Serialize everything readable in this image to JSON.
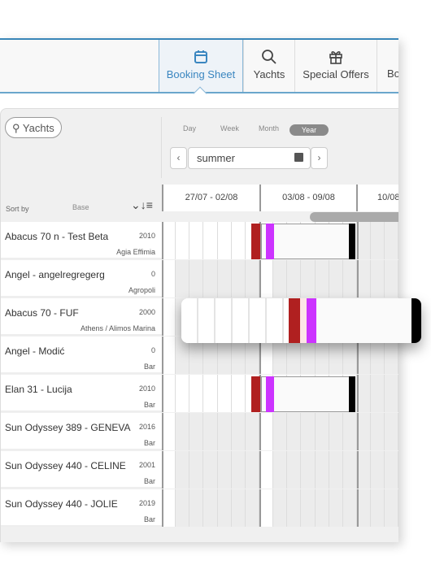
{
  "nav": {
    "tabs": [
      {
        "label": "Booking Sheet",
        "icon": "calendar-icon",
        "active": true
      },
      {
        "label": "Yachts",
        "icon": "search-icon"
      },
      {
        "label": "Special Offers",
        "icon": "gift-icon"
      },
      {
        "label": "Bo",
        "icon": ""
      }
    ]
  },
  "toolbar": {
    "search_label": "Yachts",
    "views": [
      "Day",
      "Week",
      "Month",
      "Year"
    ],
    "active_view": "Year",
    "period": "summer",
    "prev": "‹",
    "next": "›"
  },
  "list_header": {
    "sort_by": "Sort by",
    "sort_field": "Base"
  },
  "weeks": [
    "27/07 - 02/08",
    "03/08 - 09/08",
    "10/08"
  ],
  "yachts": [
    {
      "name": "Abacus 70 n - Test Beta",
      "year": "2010",
      "base": "Agia Effimia",
      "booking": true
    },
    {
      "name": "Angel - angelregregerg",
      "year": "0",
      "base": "Agropoli",
      "booking": false
    },
    {
      "name": "Abacus 70 - FUF",
      "year": "2000",
      "base": "Athens / Alimos Marina",
      "booking": false
    },
    {
      "name": "Angel - Modić",
      "year": "0",
      "base": "Bar",
      "booking": false
    },
    {
      "name": "Elan 31 - Lucija",
      "year": "2010",
      "base": "Bar",
      "booking": true
    },
    {
      "name": "Sun Odyssey 389 - GENEVA",
      "year": "2016",
      "base": "Bar",
      "booking": false
    },
    {
      "name": "Sun Odyssey 440 - CELINE",
      "year": "2001",
      "base": "Bar",
      "booking": false
    },
    {
      "name": "Sun Odyssey 440 - JOLIE",
      "year": "2019",
      "base": "Bar",
      "booking": false
    }
  ],
  "colors": {
    "accent": "#3a86c0",
    "option": "#b02020",
    "checkin": "#cc33ff",
    "checkout": "#000000"
  }
}
